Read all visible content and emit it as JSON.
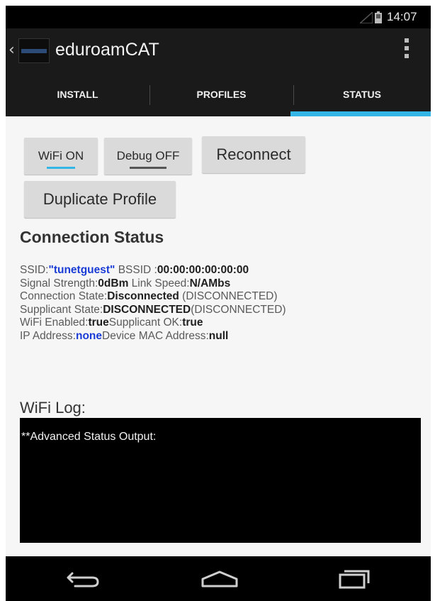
{
  "status_bar": {
    "time": "14:07",
    "icons": [
      "signal-icon",
      "battery-icon"
    ]
  },
  "action_bar": {
    "back_glyph": "‹",
    "app_name": "eduroamCAT",
    "overflow_icon": "overflow-menu-icon"
  },
  "tabs": [
    {
      "label": "INSTALL",
      "selected": false
    },
    {
      "label": "PROFILES",
      "selected": false
    },
    {
      "label": "STATUS",
      "selected": true
    }
  ],
  "buttons": {
    "wifi": "WiFi ON",
    "debug": "Debug OFF",
    "reconnect": "Reconnect",
    "duplicate": "Duplicate Profile"
  },
  "connection": {
    "title": "Connection Status",
    "ssid_label": "SSID:",
    "ssid_value": "\"tunetguest\"",
    "bssid_label": " BSSID :",
    "bssid_value": "00:00:00:00:00:00",
    "signal_label": "Signal Strength:",
    "signal_value": "0dBm",
    "speed_label": " Link Speed:",
    "speed_value": "N/AMbs",
    "conn_state_label": "Connection State:",
    "conn_state_value": "Disconnected",
    "conn_state_extra": " (DISCONNECTED)",
    "supp_state_label": "Supplicant State:",
    "supp_state_value": "DISCONNECTED",
    "supp_state_extra": "(DISCONNECTED)",
    "wifi_enabled_label": "WiFi Enabled:",
    "wifi_enabled_value": "true",
    "supp_ok_label": "Supplicant OK:",
    "supp_ok_value": "true",
    "ip_label": "IP Address:",
    "ip_value": "none",
    "mac_label": "Device MAC Address:",
    "mac_value": "null"
  },
  "log": {
    "title": "WiFi Log:",
    "output": "**Advanced Status Output:"
  },
  "nav_bar": {
    "icons": [
      "back-icon",
      "home-icon",
      "recents-icon"
    ]
  },
  "colors": {
    "accent": "#33b5e5",
    "link_blue": "#1a3cd6",
    "bar_bg": "#1a1a1a"
  }
}
